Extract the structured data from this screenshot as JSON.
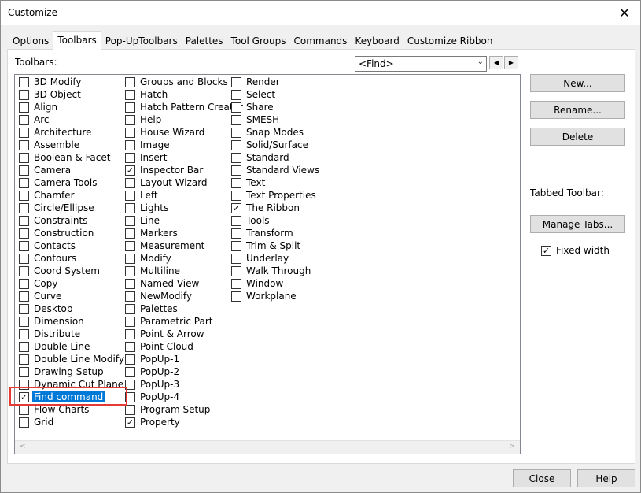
{
  "window": {
    "title": "Customize",
    "close_glyph": "✕"
  },
  "tabs": [
    {
      "label": "Options"
    },
    {
      "label": "Toolbars"
    },
    {
      "label": "Pop-UpToolbars"
    },
    {
      "label": "Palettes"
    },
    {
      "label": "Tool Groups"
    },
    {
      "label": "Commands"
    },
    {
      "label": "Keyboard"
    },
    {
      "label": "Customize Ribbon"
    }
  ],
  "toolbars_label": "Toolbars:",
  "find": {
    "value": "<Find>",
    "arrow": "⌄",
    "prev": "◀",
    "next": "▶"
  },
  "columns": [
    [
      {
        "label": "3D Modify",
        "checked": false
      },
      {
        "label": "3D Object",
        "checked": false
      },
      {
        "label": "Align",
        "checked": false
      },
      {
        "label": "Arc",
        "checked": false
      },
      {
        "label": "Architecture",
        "checked": false
      },
      {
        "label": "Assemble",
        "checked": false
      },
      {
        "label": "Boolean & Facet",
        "checked": false
      },
      {
        "label": "Camera",
        "checked": false
      },
      {
        "label": "Camera Tools",
        "checked": false
      },
      {
        "label": "Chamfer",
        "checked": false
      },
      {
        "label": "Circle/Ellipse",
        "checked": false
      },
      {
        "label": "Constraints",
        "checked": false
      },
      {
        "label": "Construction",
        "checked": false
      },
      {
        "label": "Contacts",
        "checked": false
      },
      {
        "label": "Contours",
        "checked": false
      },
      {
        "label": "Coord System",
        "checked": false
      },
      {
        "label": "Copy",
        "checked": false
      },
      {
        "label": "Curve",
        "checked": false
      },
      {
        "label": "Desktop",
        "checked": false
      },
      {
        "label": "Dimension",
        "checked": false
      },
      {
        "label": "Distribute",
        "checked": false
      },
      {
        "label": "Double Line",
        "checked": false
      },
      {
        "label": "Double Line Modify",
        "checked": false
      },
      {
        "label": "Drawing Setup",
        "checked": false
      },
      {
        "label": "Dynamic Cut Plane",
        "checked": false
      },
      {
        "label": "Find command",
        "checked": true,
        "selected": true
      },
      {
        "label": "Flow Charts",
        "checked": false
      },
      {
        "label": "Grid",
        "checked": false
      }
    ],
    [
      {
        "label": "Groups and Blocks",
        "checked": false
      },
      {
        "label": "Hatch",
        "checked": false
      },
      {
        "label": "Hatch Pattern Creator",
        "checked": false
      },
      {
        "label": "Help",
        "checked": false
      },
      {
        "label": "House Wizard",
        "checked": false
      },
      {
        "label": "Image",
        "checked": false
      },
      {
        "label": "Insert",
        "checked": false
      },
      {
        "label": "Inspector Bar",
        "checked": true
      },
      {
        "label": "Layout Wizard",
        "checked": false
      },
      {
        "label": "Left",
        "checked": false
      },
      {
        "label": "Lights",
        "checked": false
      },
      {
        "label": "Line",
        "checked": false
      },
      {
        "label": "Markers",
        "checked": false
      },
      {
        "label": "Measurement",
        "checked": false
      },
      {
        "label": "Modify",
        "checked": false
      },
      {
        "label": "Multiline",
        "checked": false
      },
      {
        "label": "Named View",
        "checked": false
      },
      {
        "label": "NewModify",
        "checked": false
      },
      {
        "label": "Palettes",
        "checked": false
      },
      {
        "label": "Parametric Part",
        "checked": false
      },
      {
        "label": "Point & Arrow",
        "checked": false
      },
      {
        "label": "Point Cloud",
        "checked": false
      },
      {
        "label": "PopUp-1",
        "checked": false
      },
      {
        "label": "PopUp-2",
        "checked": false
      },
      {
        "label": "PopUp-3",
        "checked": false
      },
      {
        "label": "PopUp-4",
        "checked": false
      },
      {
        "label": "Program Setup",
        "checked": false
      },
      {
        "label": "Property",
        "checked": true
      }
    ],
    [
      {
        "label": "Render",
        "checked": false
      },
      {
        "label": "Select",
        "checked": false
      },
      {
        "label": "Share",
        "checked": false
      },
      {
        "label": "SMESH",
        "checked": false
      },
      {
        "label": "Snap Modes",
        "checked": false
      },
      {
        "label": "Solid/Surface",
        "checked": false
      },
      {
        "label": "Standard",
        "checked": false
      },
      {
        "label": "Standard Views",
        "checked": false
      },
      {
        "label": "Text",
        "checked": false
      },
      {
        "label": "Text Properties",
        "checked": false
      },
      {
        "label": "The Ribbon",
        "checked": true
      },
      {
        "label": "Tools",
        "checked": false
      },
      {
        "label": "Transform",
        "checked": false
      },
      {
        "label": "Trim & Split",
        "checked": false
      },
      {
        "label": "Underlay",
        "checked": false
      },
      {
        "label": "Walk Through",
        "checked": false
      },
      {
        "label": "Window",
        "checked": false
      },
      {
        "label": "Workplane",
        "checked": false
      }
    ]
  ],
  "scroll": {
    "left": "<",
    "right": ">"
  },
  "buttons": {
    "new": "New...",
    "rename": "Rename...",
    "delete": "Delete",
    "manage_tabs": "Manage Tabs...",
    "close": "Close",
    "help": "Help"
  },
  "tabbed_toolbar_label": "Tabbed Toolbar:",
  "fixed_width": {
    "label": "Fixed width",
    "checked": true
  },
  "check_glyph": "✓"
}
